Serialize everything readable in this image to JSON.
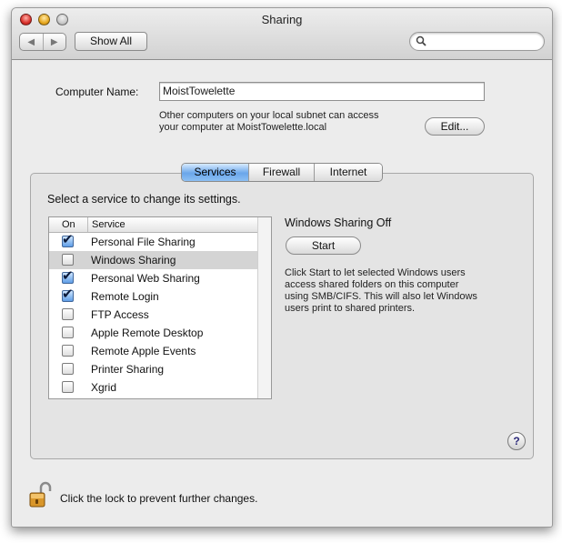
{
  "window": {
    "title": "Sharing"
  },
  "toolbar": {
    "back_icon": "back-arrow-icon",
    "forward_icon": "forward-arrow-icon",
    "show_all_label": "Show All",
    "search_placeholder": "",
    "search_icon": "magnifier-icon"
  },
  "computer": {
    "name_label": "Computer Name:",
    "name_value": "MoistTowelette",
    "info_line1": "Other computers on your local subnet can access",
    "info_line2": "your computer at MoistTowelette.local",
    "edit_label": "Edit..."
  },
  "tabs": [
    {
      "label": "Services",
      "active": true
    },
    {
      "label": "Firewall",
      "active": false
    },
    {
      "label": "Internet",
      "active": false
    }
  ],
  "services": {
    "prompt": "Select a service to change its settings.",
    "col_on": "On",
    "col_service": "Service",
    "items": [
      {
        "label": "Personal File Sharing",
        "on": true,
        "selected": false
      },
      {
        "label": "Windows Sharing",
        "on": false,
        "selected": true
      },
      {
        "label": "Personal Web Sharing",
        "on": true,
        "selected": false
      },
      {
        "label": "Remote Login",
        "on": true,
        "selected": false
      },
      {
        "label": "FTP Access",
        "on": false,
        "selected": false
      },
      {
        "label": "Apple Remote Desktop",
        "on": false,
        "selected": false
      },
      {
        "label": "Remote Apple Events",
        "on": false,
        "selected": false
      },
      {
        "label": "Printer Sharing",
        "on": false,
        "selected": false
      },
      {
        "label": "Xgrid",
        "on": false,
        "selected": false
      }
    ]
  },
  "detail": {
    "status": "Windows Sharing Off",
    "start_label": "Start",
    "desc_lines": [
      "Click Start to let selected Windows users",
      "access shared folders on this computer",
      "using SMB/CIFS. This will also let Windows",
      "users print to shared printers."
    ]
  },
  "help": {
    "label": "?"
  },
  "lock": {
    "text": "Click the lock to prevent further changes.",
    "icon": "padlock-open-icon"
  },
  "colors": {
    "accent": "#6aa6ea",
    "selection": "#d4d4d4"
  }
}
